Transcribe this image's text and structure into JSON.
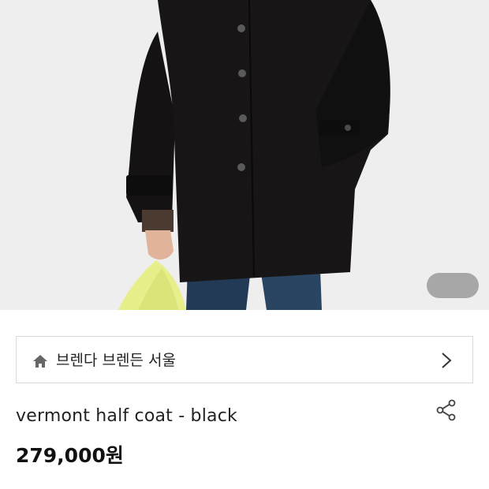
{
  "hero": {
    "image_desc_icon": "product-photo"
  },
  "shop": {
    "name": "브렌다 브렌든 서울",
    "home_icon": "home-icon",
    "chevron_icon": "chevron-right-icon"
  },
  "product": {
    "title": "vermont half coat - black",
    "price": "279,000원",
    "share_icon": "share-icon"
  }
}
